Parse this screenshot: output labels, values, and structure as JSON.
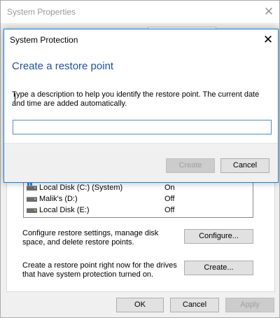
{
  "background_window": {
    "title": "System Properties",
    "close_glyph": "✕",
    "drives": [
      {
        "name": "Local Disk (C:) (System)",
        "status": "On",
        "icon": "system-drive-icon"
      },
      {
        "name": "Malik's (D:)",
        "status": "Off",
        "icon": "drive-icon"
      },
      {
        "name": "Local Disk (E:)",
        "status": "Off",
        "icon": "drive-icon"
      }
    ],
    "configure": {
      "description": "Configure restore settings, manage disk space, and delete restore points.",
      "button_label": "Configure..."
    },
    "create": {
      "description": "Create a restore point right now for the drives that have system protection turned on.",
      "button_label": "Create..."
    },
    "footer": {
      "ok": "OK",
      "cancel": "Cancel",
      "apply": "Apply"
    }
  },
  "dialog": {
    "title": "System Protection",
    "close_glyph": "✕",
    "heading": "Create a restore point",
    "instructions": "Type a description to help you identify the restore point. The current date and time are added automatically.",
    "input_value": "",
    "create_label": "Create",
    "cancel_label": "Cancel"
  },
  "colors": {
    "accent": "#1883d7",
    "heading": "#1d51a8",
    "disabled_text": "#a0a0a0"
  }
}
